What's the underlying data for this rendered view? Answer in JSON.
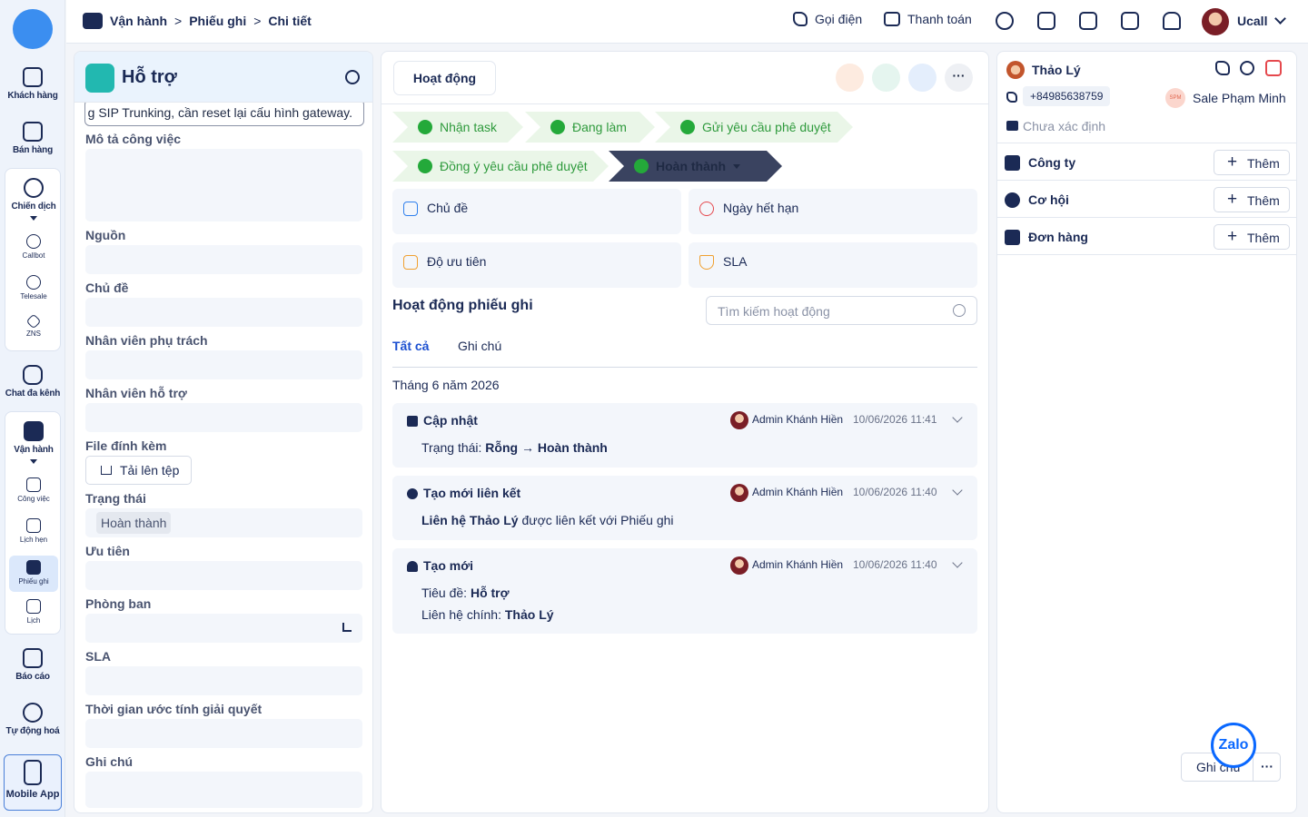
{
  "nav": {
    "items": [
      "Khách hàng",
      "Bán hàng",
      "Chiến dịch",
      "Chat đa kênh",
      "Vận hành",
      "Báo cáo",
      "Tự động hoá"
    ],
    "campaign_sub": [
      "Callbot",
      "Telesale",
      "ZNS"
    ],
    "ops_sub": [
      "Công việc",
      "Lịch hẹn",
      "Phiếu ghi",
      "Lịch"
    ],
    "mobile": "Mobile App"
  },
  "topbar": {
    "crumbs": [
      "Vận hành",
      "Phiếu ghi",
      "Chi tiết"
    ],
    "call": "Gọi điện",
    "payment": "Thanh toán",
    "user": "Ucall"
  },
  "left": {
    "title": "Hỗ trợ",
    "headline_value": "g SIP Trunking, cần reset lại cấu hình gateway.",
    "labels": {
      "desc": "Mô tả công việc",
      "source": "Nguồn",
      "topic": "Chủ đề",
      "owner": "Nhân viên phụ trách",
      "support": "Nhân viên hỗ trợ",
      "attach": "File đính kèm",
      "status": "Trạng thái",
      "priority": "Ưu tiên",
      "dept": "Phòng ban",
      "sla": "SLA",
      "eta": "Thời gian ước tính giải quyết",
      "note": "Ghi chú"
    },
    "upload": "Tải lên tệp",
    "status_value": "Hoàn thành"
  },
  "mid": {
    "tab": "Hoạt động",
    "stages": [
      "Nhận task",
      "Đang làm",
      "Gửi yêu cầu phê duyệt",
      "Đồng ý yêu cầu phê duyệt",
      "Hoàn thành"
    ],
    "cards": [
      "Chủ đề",
      "Ngày hết hạn",
      "Độ ưu tiên",
      "SLA"
    ],
    "section": "Hoạt động phiếu ghi",
    "search_placeholder": "Tìm kiếm hoạt động",
    "filters": [
      "Tất cả",
      "Ghi chú"
    ],
    "month": "Tháng 6 năm 2026",
    "activities": [
      {
        "title": "Cập nhật",
        "who": "Admin Khánh Hiền",
        "when": "10/06/2026 11:41",
        "l1a": "Trạng thái: ",
        "l1b": "Rỗng → Hoàn thành"
      },
      {
        "title": "Tạo mới liên kết",
        "who": "Admin Khánh Hiền",
        "when": "10/06/2026 11:40",
        "l1a": "Liên hệ Thảo Lý",
        "l1b": " được liên kết với Phiếu ghi"
      },
      {
        "title": "Tạo mới",
        "who": "Admin Khánh Hiền",
        "when": "10/06/2026 11:40",
        "l1a": "Tiêu đề: ",
        "l1b": "Hỗ trợ",
        "l2a": "Liên hệ chính: ",
        "l2b": "Thảo Lý"
      }
    ]
  },
  "right": {
    "name": "Thảo Lý",
    "phone": "+84985638759",
    "owner_badge": "SPM",
    "owner": "Sale Phạm Minh",
    "email": "Chưa xác định",
    "sections": [
      "Công ty",
      "Cơ hội",
      "Đơn hàng"
    ],
    "add": "Thêm"
  },
  "footer": {
    "zalo": "Zalo",
    "note": "Ghi chú",
    "more": "···"
  }
}
